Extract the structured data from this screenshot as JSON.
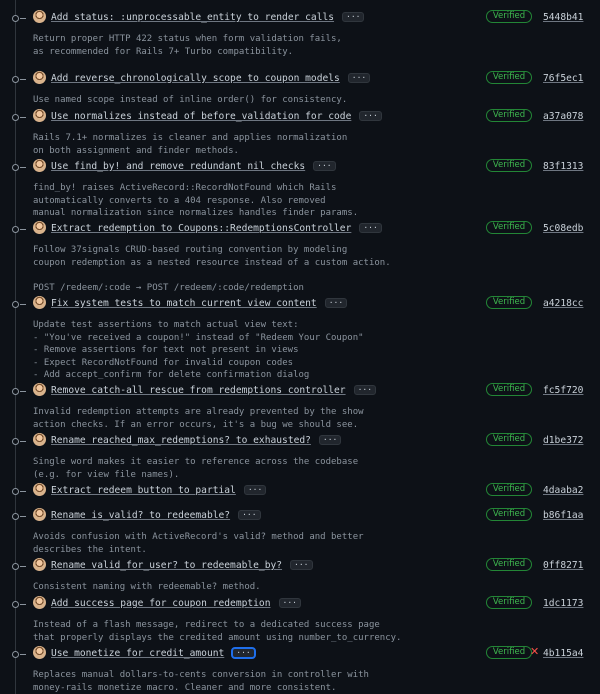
{
  "badge_label": "Verified",
  "commits": [
    {
      "title": "Add status: :unprocessable_entity to render calls",
      "sha": "5448b41",
      "description": "Return proper HTTP 422 status when form validation fails,\nas recommended for Rails 7+ Turbo compatibility.",
      "check": ""
    },
    {
      "title": "Add reverse_chronologically scope to coupon models",
      "sha": "76f5ec1",
      "description": "Use named scope instead of inline order() for consistency.",
      "check": ""
    },
    {
      "title": "Use normalizes instead of before_validation for code",
      "sha": "a37a078",
      "description": "Rails 7.1+ normalizes is cleaner and applies normalization\non both assignment and finder methods.",
      "check": ""
    },
    {
      "title": "Use find_by! and remove redundant nil checks",
      "sha": "83f1313",
      "description": "find_by! raises ActiveRecord::RecordNotFound which Rails\nautomatically converts to a 404 response. Also removed\nmanual normalization since normalizes handles finder params.",
      "check": ""
    },
    {
      "title": "Extract redemption to Coupons::RedemptionsController",
      "sha": "5c08edb",
      "description": "Follow 37signals CRUD-based routing convention by modeling\ncoupon redemption as a nested resource instead of a custom action.\n\nPOST /redeem/:code → POST /redeem/:code/redemption",
      "check": ""
    },
    {
      "title": "Fix system tests to match current view content",
      "sha": "a4218cc",
      "description": "Update test assertions to match actual view text:\n- \"You've received a coupon!\" instead of \"Redeem Your Coupon\"\n- Remove assertions for text not present in views\n- Expect RecordNotFound for invalid coupon codes\n- Add accept_confirm for delete confirmation dialog",
      "check": ""
    },
    {
      "title": "Remove catch-all rescue from redemptions controller",
      "sha": "fc5f720",
      "description": "Invalid redemption attempts are already prevented by the show\naction checks. If an error occurs, it's a bug we should see.",
      "check": ""
    },
    {
      "title": "Rename reached_max_redemptions? to exhausted?",
      "sha": "d1be372",
      "description": "Single word makes it easier to reference across the codebase\n(e.g. for view file names).",
      "check": ""
    },
    {
      "title": "Extract redeem button to partial",
      "sha": "4daaba2",
      "description": "",
      "check": ""
    },
    {
      "title": "Rename is_valid? to redeemable?",
      "sha": "b86f1aa",
      "description": "Avoids confusion with ActiveRecord's valid? method and better\ndescribes the intent.",
      "check": ""
    },
    {
      "title": "Rename valid_for_user? to redeemable_by?",
      "sha": "0ff8271",
      "description": "Consistent naming with redeemable? method.",
      "check": ""
    },
    {
      "title": "Add success page for coupon redemption",
      "sha": "1dc1173",
      "description": "Instead of a flash message, redirect to a dedicated success page\nthat properly displays the credited amount using number_to_currency.",
      "check": ""
    },
    {
      "title": "Use monetize for credit_amount",
      "sha": "4b115a4",
      "description": "Replaces manual dollars-to-cents conversion in controller with\nmoney-rails monetize macro. Cleaner and more consistent.",
      "check": "✕"
    }
  ]
}
